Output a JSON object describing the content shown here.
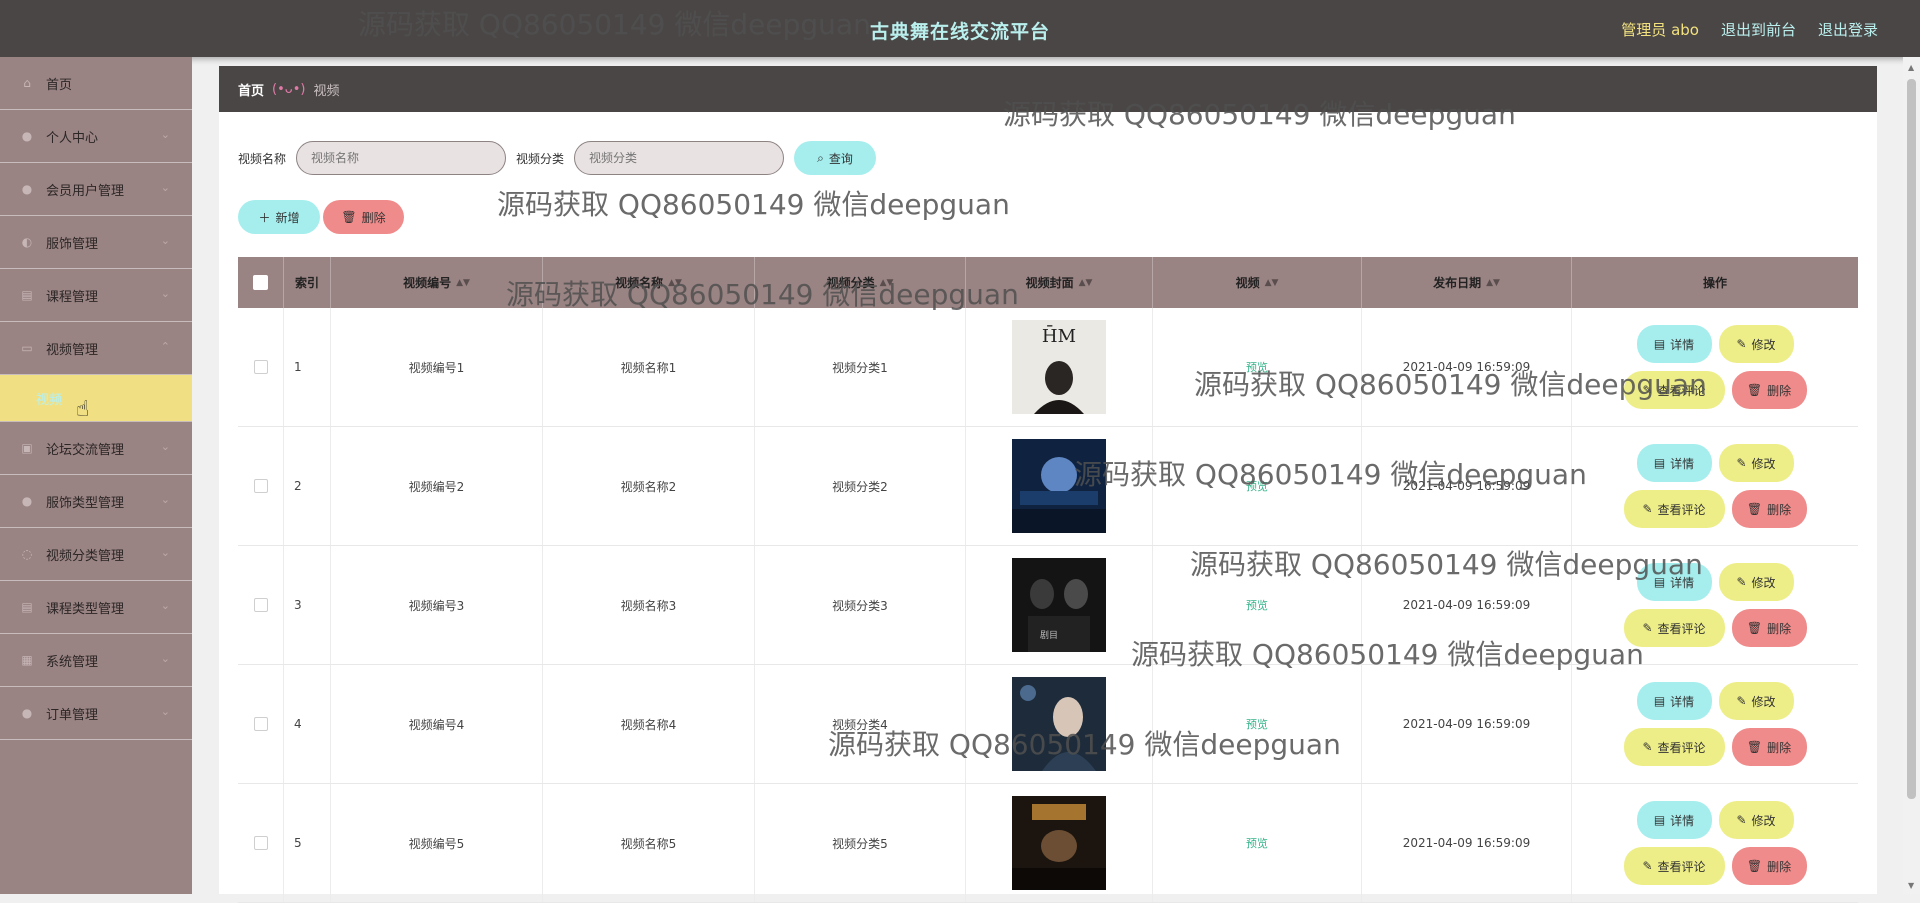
{
  "header": {
    "title": "古典舞在线交流平台",
    "admin": "管理员 abo",
    "back_front": "退出到前台",
    "logout": "退出登录"
  },
  "sidebar": {
    "items": [
      {
        "label": "首页",
        "icon": "home-icon"
      },
      {
        "label": "个人中心",
        "icon": "user-icon"
      },
      {
        "label": "会员用户管理",
        "icon": "users-icon"
      },
      {
        "label": "服饰管理",
        "icon": "shirt-icon"
      },
      {
        "label": "课程管理",
        "icon": "book-icon"
      },
      {
        "label": "视频管理",
        "icon": "video-icon"
      }
    ],
    "sub_item": "视频",
    "items_after": [
      {
        "label": "论坛交流管理",
        "icon": "chat-icon"
      },
      {
        "label": "服饰类型管理",
        "icon": "tag-icon"
      },
      {
        "label": "视频分类管理",
        "icon": "category-icon"
      },
      {
        "label": "课程类型管理",
        "icon": "list-icon"
      },
      {
        "label": "系统管理",
        "icon": "gear-icon"
      },
      {
        "label": "订单管理",
        "icon": "order-icon"
      }
    ]
  },
  "breadcrumb": {
    "home": "首页",
    "emoticon": "(•ᴗ•)",
    "current": "视频"
  },
  "search": {
    "name_label": "视频名称",
    "name_placeholder": "视频名称",
    "category_label": "视频分类",
    "category_placeholder": "视频分类",
    "query_button": "查询"
  },
  "actions": {
    "add": "新增",
    "delete": "删除"
  },
  "table": {
    "columns": [
      "索引",
      "视频编号",
      "视频名称",
      "视频分类",
      "视频封面",
      "视频",
      "发布日期",
      "操作"
    ],
    "rows": [
      {
        "index": "1",
        "code": "视频编号1",
        "name": "视频名称1",
        "category": "视频分类1",
        "video": "预览",
        "date": "2021-04-09 16:59:09"
      },
      {
        "index": "2",
        "code": "视频编号2",
        "name": "视频名称2",
        "category": "视频分类2",
        "video": "预览",
        "date": "2021-04-09 16:59:09"
      },
      {
        "index": "3",
        "code": "视频编号3",
        "name": "视频名称3",
        "category": "视频分类3",
        "video": "预览",
        "date": "2021-04-09 16:59:09"
      },
      {
        "index": "4",
        "code": "视频编号4",
        "name": "视频名称4",
        "category": "视频分类4",
        "video": "预览",
        "date": "2021-04-09 16:59:09"
      },
      {
        "index": "5",
        "code": "视频编号5",
        "name": "视频名称5",
        "category": "视频分类5",
        "video": "预览",
        "date": "2021-04-09 16:59:09"
      }
    ],
    "ops": {
      "detail": "详情",
      "edit": "修改",
      "comment": "查看评论",
      "remove": "删除"
    }
  },
  "watermark": "源码获取 QQ86050149 微信deepguan",
  "colors": {
    "topbar": "#4b4646",
    "sidebar": "#9a8383",
    "active_sub": "#f0e083",
    "teal_button": "#a6eeee",
    "yellow_button": "#eeee88",
    "red_button": "#f08b8b"
  }
}
